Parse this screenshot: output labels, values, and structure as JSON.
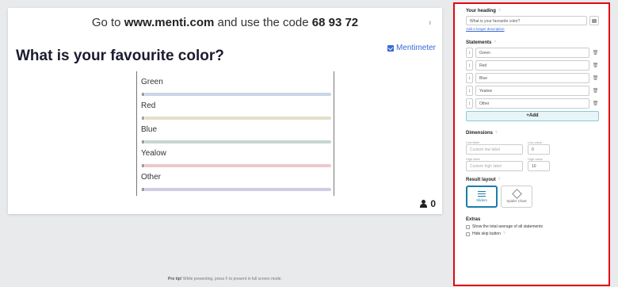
{
  "presentation": {
    "join_prefix": "Go to ",
    "join_url": "www.menti.com",
    "join_middle": " and use the code ",
    "join_code": "68 93 72",
    "corner_glyph": "ı",
    "question": "What is your favourite color?",
    "brand_name": "Mentimeter",
    "voter_count": "0",
    "statements": [
      {
        "label": "Green",
        "color": "#c9d6e6",
        "value": 0
      },
      {
        "label": "Red",
        "color": "#e3dfc9",
        "value": 0
      },
      {
        "label": "Blue",
        "color": "#c6d7d3",
        "value": 0
      },
      {
        "label": "Yealow",
        "color": "#ecc8cc",
        "value": 0
      },
      {
        "label": "Other",
        "color": "#cfcce3",
        "value": 0
      }
    ],
    "protip_bold": "Pro tip!",
    "protip_text": " While presenting, press ",
    "protip_key": "F",
    "protip_end": " to present in full screen mode."
  },
  "panel": {
    "heading_title": "Your heading",
    "heading_value": "What is your favourite color?",
    "longer_desc_link": "Add a longer description",
    "statements_title": "Statements",
    "statements": [
      "Green",
      "Red",
      "Blue",
      "Yealow",
      "Other"
    ],
    "add_label": "+Add",
    "dimensions_title": "Dimensions",
    "low_label_caption": "Low label",
    "low_label_placeholder": "Custom low label",
    "low_value_caption": "Low value",
    "low_value": "0",
    "high_label_caption": "High label",
    "high_label_placeholder": "Custom high label",
    "high_value_caption": "High value",
    "high_value": "10",
    "layout_title": "Result layout",
    "layout_sliders": "Sliders",
    "layout_spider": "Spider Chart",
    "extras_title": "Extras",
    "extra_average": "Show the total average of all statements",
    "extra_skip": "Hide skip button",
    "help_glyph": "?",
    "drag_glyph": "↕",
    "trash_glyph": "🗑"
  },
  "colors": {
    "accent": "#3968d8",
    "panel_border": "#e30613",
    "active_layout": "#1a7ea8"
  }
}
